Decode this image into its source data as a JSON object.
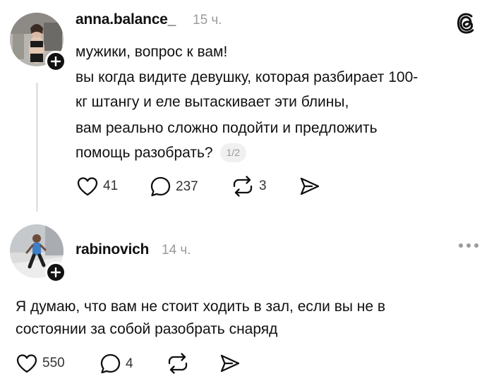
{
  "post": {
    "username": "anna.balance_",
    "time": "15 ч.",
    "lines": [
      "мужики, вопрос к вам!",
      "вы когда видите девушку, которая разбирает 100-",
      "кг штангу и еле вытаскивает эти блины,",
      "вам реально сложно подойти и предложить",
      "помощь разобрать?"
    ],
    "page_indicator": "1/2",
    "likes": "41",
    "comments": "237",
    "reposts": "3"
  },
  "reply": {
    "username": "rabinovich",
    "time": "14 ч.",
    "lines": [
      "Я думаю, что вам не стоит ходить в зал, если вы не в",
      "состоянии за собой разобрать снаряд"
    ],
    "likes": "550",
    "comments": "4"
  },
  "icons": {
    "app_logo": "threads-logo-icon",
    "follow": "plus-icon",
    "like": "heart-icon",
    "comment": "comment-bubble-icon",
    "repost": "repost-icon",
    "share": "send-icon",
    "more": "more-dots-icon"
  },
  "colors": {
    "text": "#111111",
    "muted": "#9a9a9a",
    "thread_line": "#e3e3e3"
  }
}
